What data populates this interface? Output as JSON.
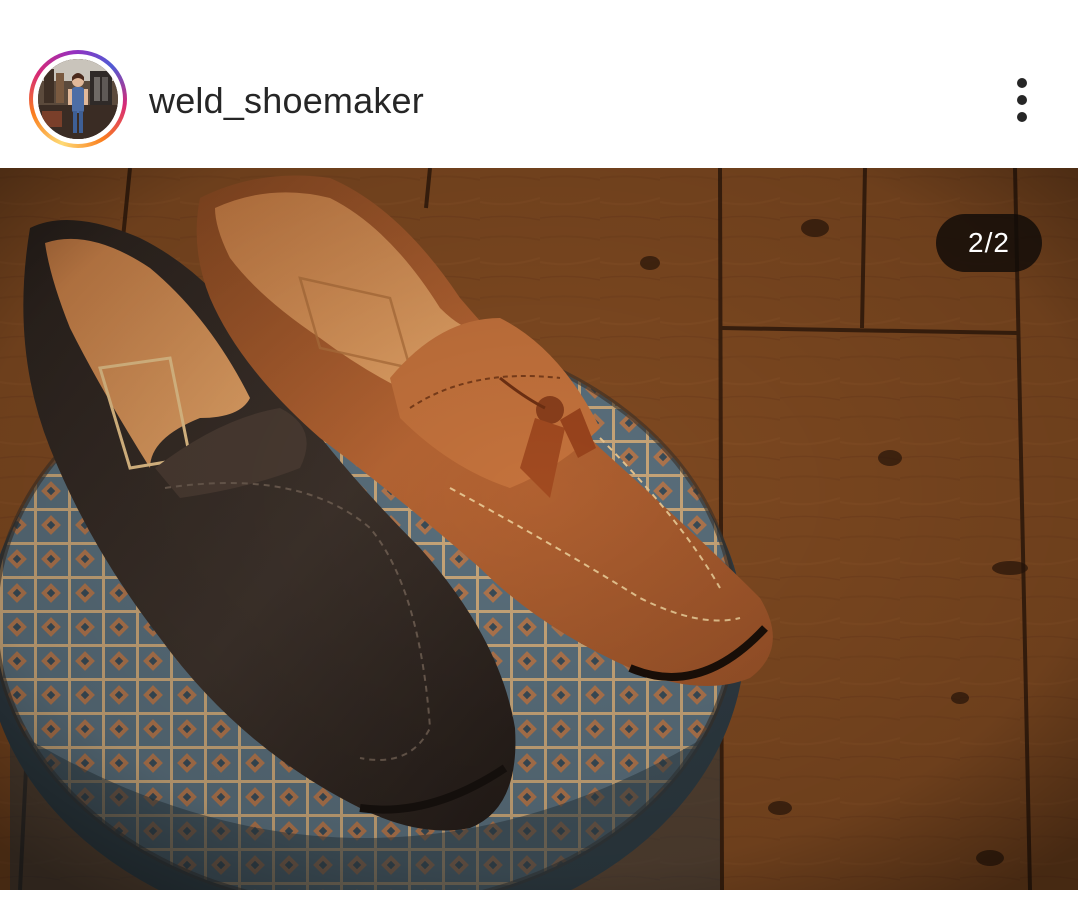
{
  "post": {
    "username": "weld_shoemaker",
    "avatar_icon": "profile-photo-shoemaker",
    "more_icon": "more-vertical-icon",
    "carousel_counter": "2/2",
    "story_ring_colors": [
      "#feda75",
      "#fa7e1e",
      "#d62976",
      "#962fbf",
      "#4f5bd5"
    ]
  }
}
